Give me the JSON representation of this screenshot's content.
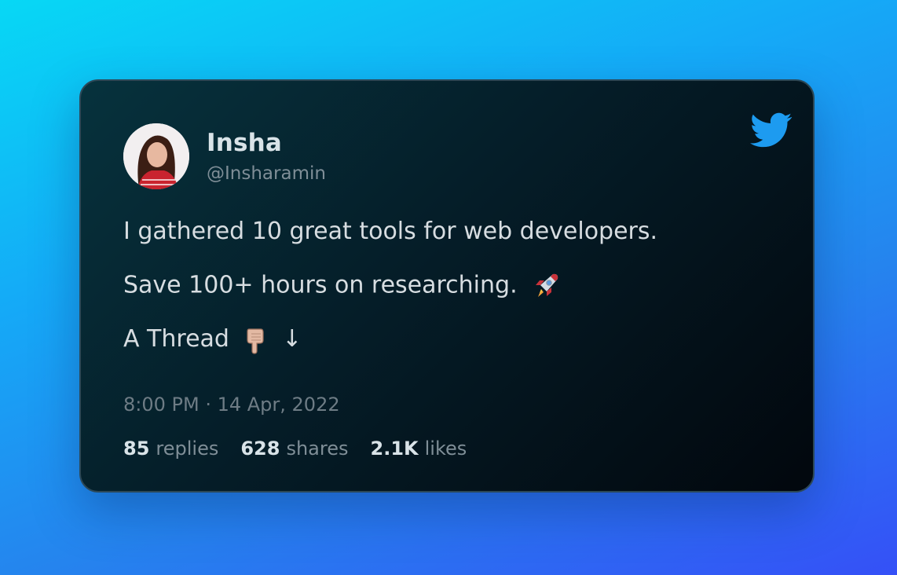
{
  "author": {
    "name": "Insha",
    "handle": "@Insharamin"
  },
  "tweet": {
    "lines": [
      "I gathered 10 great tools for web developers.",
      "Save 100+ hours on researching.",
      "A Thread"
    ],
    "thread_arrow": "↓",
    "timestamp": "8:00 PM · 14 Apr, 2022"
  },
  "stats": [
    {
      "count": "85",
      "label": "replies"
    },
    {
      "count": "628",
      "label": "shares"
    },
    {
      "count": "2.1K",
      "label": "likes"
    }
  ],
  "icons": {
    "brand": "twitter-bird-icon",
    "line2_emoji": "rocket-icon",
    "line3_emoji": "pointing-down-hand-icon"
  },
  "colors": {
    "twitter_blue": "#1d9bf0"
  }
}
